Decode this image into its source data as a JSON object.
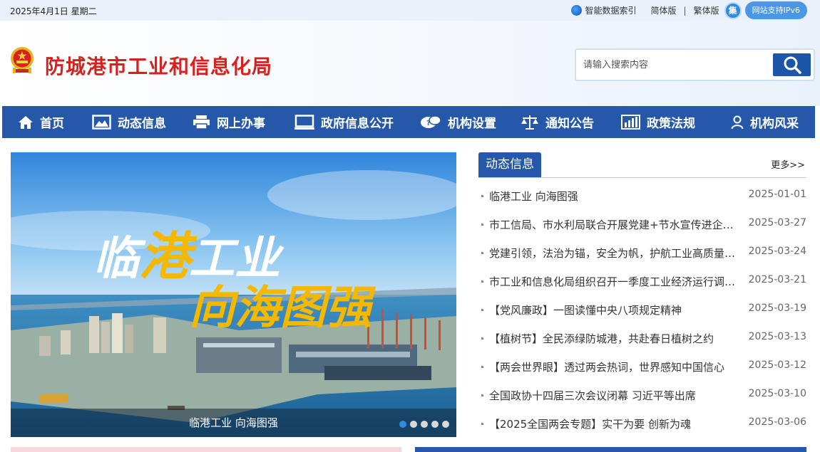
{
  "topbar": {
    "date": "2025年4月1日  星期二",
    "ai_search": "智能数据索引",
    "simplified": "简体版",
    "separator": "|",
    "traditional": "繁体版",
    "badge": "集",
    "ipv6": "网站支持IPv6"
  },
  "header": {
    "title": "防城港市工业和信息化局",
    "search_placeholder": "请输入搜索内容"
  },
  "nav": {
    "items": [
      {
        "label": "首页",
        "icon": "home-icon"
      },
      {
        "label": "动态信息",
        "icon": "image-icon"
      },
      {
        "label": "网上办事",
        "icon": "printer-icon"
      },
      {
        "label": "政府信息公开",
        "icon": "monitor-icon"
      },
      {
        "label": "机构设置",
        "icon": "speech-icon"
      },
      {
        "label": "通知公告",
        "icon": "scale-icon"
      },
      {
        "label": "政策法规",
        "icon": "bar-chart-icon"
      },
      {
        "label": "机构风采",
        "icon": "person-icon"
      }
    ]
  },
  "banner": {
    "caption": "临港工业 向海图强",
    "line1_a": "临",
    "line1_b": "港",
    "line1_c": "工业",
    "line2": "向海图强",
    "slide_count": 5,
    "active_slide": 1
  },
  "news": {
    "tab": "动态信息",
    "more": "更多>>",
    "items": [
      {
        "title": "临港工业 向海图强",
        "date": "2025-01-01"
      },
      {
        "title": "市工信局、市水利局联合开展党建+节水宣传进企业活动",
        "date": "2025-03-27"
      },
      {
        "title": "党建引领，法治为锚，安全为帆，护航工业高质量发展",
        "date": "2025-03-24"
      },
      {
        "title": "市工业和信息化局组织召开一季度工业经济运行调度会",
        "date": "2025-03-21"
      },
      {
        "title": "【党风廉政】一图读懂中央八项规定精神",
        "date": "2025-03-19"
      },
      {
        "title": "【植树节】全民添绿防城港，共赴春日植树之约",
        "date": "2025-03-13"
      },
      {
        "title": "【两会世界眼】透过两会热词，世界感知中国信心",
        "date": "2025-03-12"
      },
      {
        "title": "全国政协十四届三次会议闭幕 习近平等出席",
        "date": "2025-03-10"
      },
      {
        "title": "【2025全国两会专题】实干为要 创新为魂",
        "date": "2025-03-06"
      }
    ]
  },
  "colors": {
    "nav_bg": "#2658a9",
    "title_red": "#d6211f",
    "accent_gold": "#f5b800"
  }
}
